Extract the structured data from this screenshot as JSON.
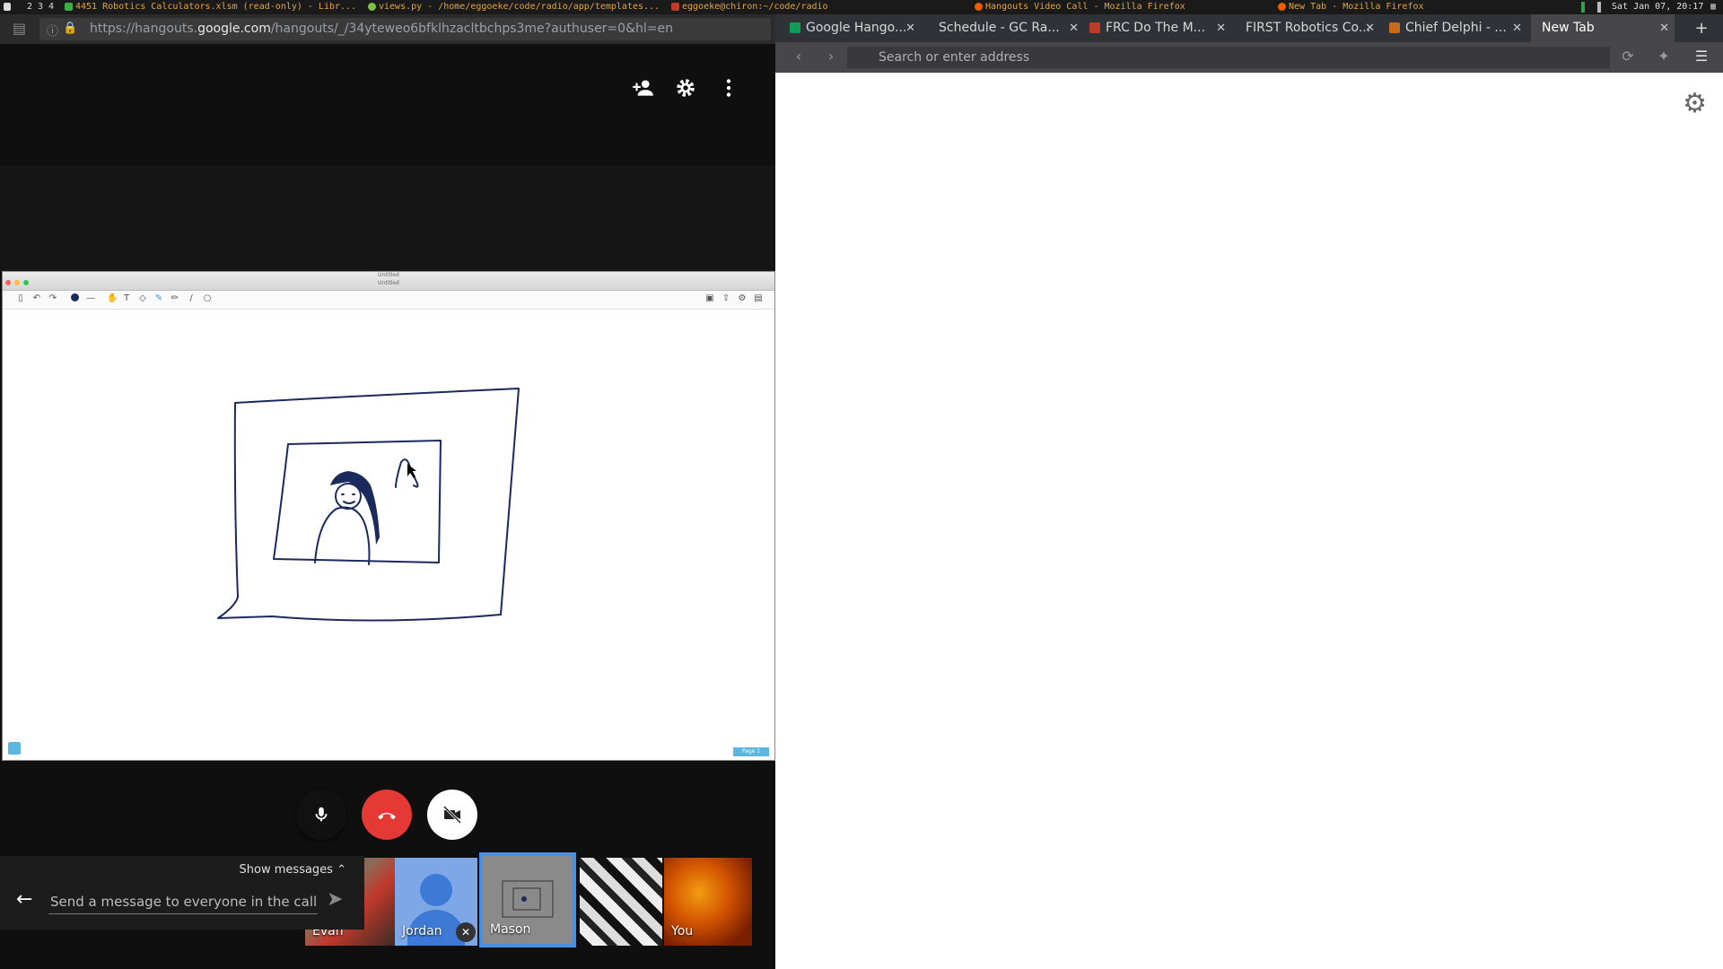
{
  "wm": {
    "workspaces": [
      "2",
      "3",
      "4"
    ],
    "tasks": [
      "4451 Robotics Calculators.xlsm (read-only) - Libr...",
      "views.py - /home/eggoeke/code/radio/app/templates...",
      "eggoeke@chiron:~/code/radio",
      "Hangouts Video Call - Mozilla Firefox",
      "New Tab - Mozilla Firefox"
    ],
    "clock": "Sat Jan 07, 20:17",
    "colors": {
      "accent": "#e8a33d"
    }
  },
  "hangouts": {
    "url_prefix": "https://hangouts.",
    "url_domain": "google.com",
    "url_rest": "/hangouts/_/34yteweo6bfklhzacltbchps3me?authuser=0&hl=en",
    "share": {
      "title_line1": "Untitled",
      "title_line2": "Untitled",
      "page_tag": "Page 1"
    },
    "controls": {
      "mic_icon": "mic-icon",
      "hangup_icon": "phone-hangup-icon",
      "camera_icon": "camera-off-icon"
    },
    "chat": {
      "show_messages": "Show messages",
      "placeholder": "Send a message to everyone in the call"
    },
    "participants": [
      {
        "name": "Evan"
      },
      {
        "name": "Jordan"
      },
      {
        "name": "Mason"
      },
      {
        "name": ""
      },
      {
        "name": "You"
      }
    ],
    "colors": {
      "hangup": "#e53935",
      "selected": "#4a90e2"
    }
  },
  "firefox": {
    "tabs": [
      {
        "label": "Google Hango..."
      },
      {
        "label": "Schedule - GC Ra..."
      },
      {
        "label": "FRC Do The M..."
      },
      {
        "label": "FIRST Robotics Co..."
      },
      {
        "label": "Chief Delphi - ..."
      },
      {
        "label": "New Tab"
      }
    ],
    "address_placeholder": "Search or enter address",
    "new_tab_plus": "+"
  }
}
